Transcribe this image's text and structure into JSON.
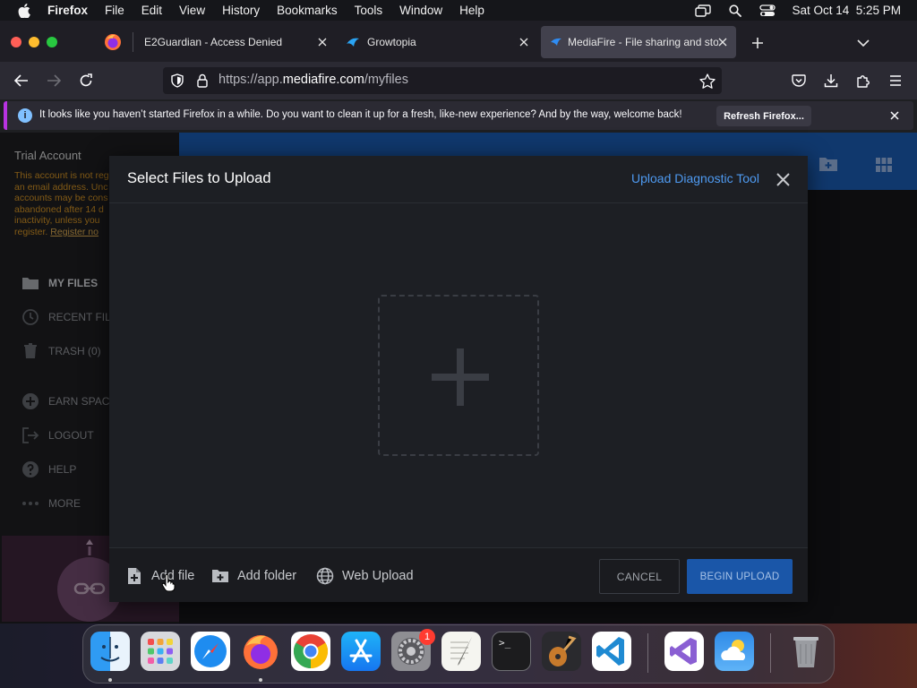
{
  "menubar": {
    "app_name": "Firefox",
    "items": [
      "File",
      "Edit",
      "View",
      "History",
      "Bookmarks",
      "Tools",
      "Window",
      "Help"
    ],
    "datetime": "Sat Oct 14  5:25 PM"
  },
  "tabs": [
    {
      "title": "E2Guardian - Access Denied"
    },
    {
      "title": "Growtopia"
    },
    {
      "title": "MediaFire - File sharing and sto"
    }
  ],
  "url": {
    "prefix": "https://app.",
    "host": "mediafire.com",
    "path": "/myfiles"
  },
  "notification": {
    "info_glyph": "i",
    "message": "It looks like you haven’t started Firefox in a while. Do you want to clean it up for a fresh, like-new experience? And by the way, welcome back!",
    "button_label": "Refresh Firefox..."
  },
  "sidebar": {
    "trial_title": "Trial Account",
    "trial_message": "This account is not reg\nan email address. Unc\naccounts may be cons\nabandoned after 14 d\ninactivity, unless you\nregister. ",
    "register_link": "Register no",
    "items": [
      {
        "label": "MY FILES",
        "icon": "folder-icon"
      },
      {
        "label": "RECENT FIL",
        "icon": "clock-icon"
      },
      {
        "label": "TRASH (0)",
        "icon": "trash-icon"
      },
      {
        "label": "EARN SPAC",
        "icon": "plus-circle-icon"
      },
      {
        "label": "LOGOUT",
        "icon": "logout-icon"
      },
      {
        "label": "HELP",
        "icon": "help-icon"
      },
      {
        "label": "MORE",
        "icon": "more-icon"
      }
    ]
  },
  "modal": {
    "title": "Select Files to Upload",
    "diagnostic_link": "Upload Diagnostic Tool",
    "actions": {
      "add_file": "Add file",
      "add_folder": "Add folder",
      "web_upload": "Web Upload"
    },
    "cancel_label": "CANCEL",
    "begin_label": "BEGIN UPLOAD"
  },
  "dock": {
    "apps": [
      "Finder",
      "Launchpad",
      "Safari",
      "Firefox",
      "Chrome",
      "App Store",
      "System Settings",
      "TextEdit",
      "Terminal",
      "GarageBand",
      "Visual Studio Code",
      "Visual Studio",
      "Weather",
      "Trash"
    ],
    "badge_count": "1",
    "terminal_prompt": ">_"
  },
  "colors": {
    "accent_blue": "#1a56a8",
    "link_blue": "#4e9af1",
    "warning_orange": "#c88a22",
    "notification_accent": "#b833e1"
  }
}
